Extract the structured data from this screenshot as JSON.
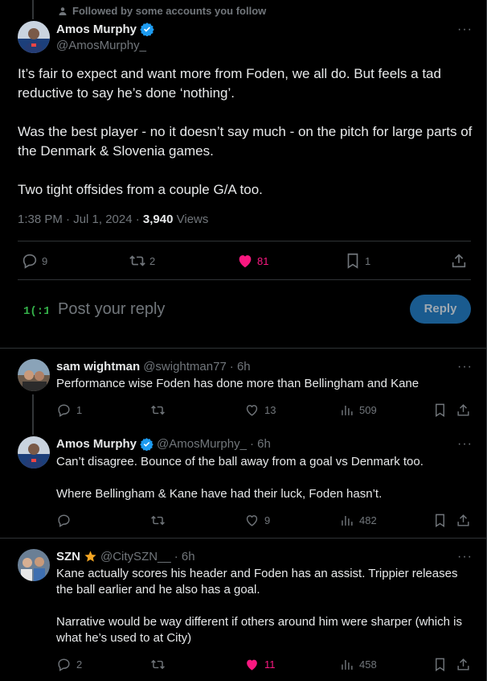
{
  "main": {
    "social_context": "Followed by some accounts you follow",
    "author_name": "Amos Murphy",
    "author_handle": "@AmosMurphy_",
    "paragraphs": [
      "It’s fair to expect and want more from Foden, we all do. But feels a tad reductive to say he’s done ‘nothing’.",
      "Was the best player - no it doesn’t say much - on the pitch for large parts of the Denmark & Slovenia games.",
      "Two tight offsides from a couple G/A too."
    ],
    "timestamp": "1:38 PM · Jul 1, 2024 · ",
    "views_count": "3,940",
    "views_label": " Views",
    "actions": {
      "replies": "9",
      "reposts": "2",
      "likes": "81",
      "bookmarks": "1"
    },
    "colors": {
      "like": "#f91880",
      "verified": "#1d9bf0",
      "reply_button": "#1a5b8f"
    }
  },
  "composer": {
    "placeholder": "Post your reply",
    "reply_button": "Reply"
  },
  "replies": [
    {
      "name": "sam wightman",
      "handle": "@swightman77",
      "time": "· 6h",
      "text": [
        "Performance wise Foden has done more than Bellingham and Kane"
      ],
      "replies": "1",
      "reposts": "",
      "likes": "13",
      "views": "509"
    },
    {
      "name": "Amos Murphy",
      "handle": "@AmosMurphy_",
      "time": "· 6h",
      "text": [
        "Can’t disagree. Bounce of the ball away from a goal vs Denmark too.",
        "Where Bellingham & Kane have had their luck, Foden hasn’t."
      ],
      "replies": "",
      "reposts": "",
      "likes": "9",
      "views": "482"
    },
    {
      "name": "SZN",
      "handle": "@CitySZN__",
      "time": "· 6h",
      "text": [
        "Kane actually scores his header and Foden has an assist. Trippier releases the ball earlier and he also has a goal.",
        "Narrative would be way different if others around him were sharper (which is what he’s used to at City)"
      ],
      "replies": "2",
      "reposts": "",
      "likes": "11",
      "views": "458"
    }
  ]
}
